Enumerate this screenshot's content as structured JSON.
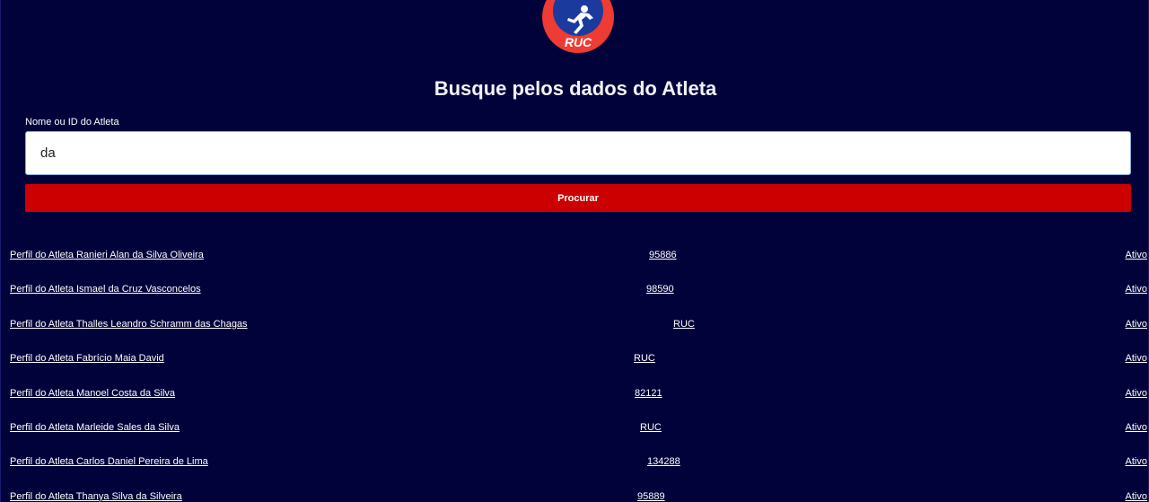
{
  "logo": {
    "text": "RUC",
    "icon": "runner-icon"
  },
  "page": {
    "title": "Busque pelos dados do Atleta"
  },
  "search": {
    "label": "Nome ou ID do Atleta",
    "value": "da",
    "button_label": "Procurar"
  },
  "results": [
    {
      "name": "Perfil do Atleta Ranieri Alan da Silva Oliveira",
      "id": "95886",
      "status": "Ativo"
    },
    {
      "name": "Perfil do Atleta Ismael da Cruz Vasconcelos",
      "id": "98590",
      "status": "Ativo"
    },
    {
      "name": "Perfil do Atleta Thalles Leandro Schramm das Chagas",
      "id": "RUC",
      "status": "Ativo"
    },
    {
      "name": "Perfil do Atleta Fabrício Maia David",
      "id": "RUC",
      "status": "Ativo"
    },
    {
      "name": "Perfil do Atleta Manoel Costa da Silva",
      "id": "82121",
      "status": "Ativo"
    },
    {
      "name": "Perfil do Atleta Marleide Sales da Silva",
      "id": "RUC",
      "status": "Ativo"
    },
    {
      "name": "Perfil do Atleta Carlos Daniel Pereira de Lima",
      "id": "134288",
      "status": "Ativo"
    },
    {
      "name": "Perfil do Atleta Thanya Silva da Silveira",
      "id": "95889",
      "status": "Ativo"
    }
  ]
}
